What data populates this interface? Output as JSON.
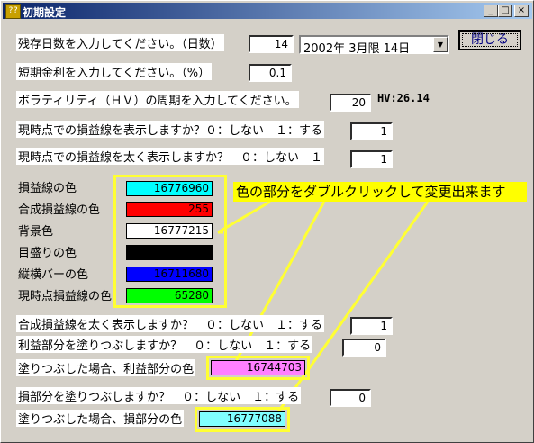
{
  "window": {
    "title": "初期設定",
    "icon_text": "??",
    "icon": "app-icon"
  },
  "caption_buttons": {
    "minimize": "_",
    "maximize": "□",
    "close": "×"
  },
  "days": {
    "label": "残存日数を入力してください。（日数）",
    "value": "14",
    "expiry_selected": "2002年 3月限  14日",
    "dropdown_icon": "▼"
  },
  "close_button_label": "閉じる",
  "rate": {
    "label": "短期金利を入力してください。（%）",
    "value": "0.1"
  },
  "hv": {
    "label": "ボラティリティ（ＨＶ）の周期を入力してください。",
    "value": "20",
    "readout": "HV:26.14"
  },
  "show_pl_line": {
    "label": "現時点での損益線を表示しますか？０：しない　１：する",
    "value": "1"
  },
  "bold_pl_line": {
    "label": "現時点での損益線を太く表示しますか？　０：しない　１",
    "value": "1"
  },
  "colors": [
    {
      "label": "損益線の色",
      "value": "16776960",
      "color": "#00ffff"
    },
    {
      "label": "合成損益線の色",
      "value": "255",
      "color": "#ff0000"
    },
    {
      "label": "背景色",
      "value": "16777215",
      "color": "#ffffff"
    },
    {
      "label": "目盛りの色",
      "value": "",
      "color": "#000000"
    },
    {
      "label": "縦横バーの色",
      "value": "16711680",
      "color": "#0000ff"
    },
    {
      "label": "現時点損益線の色",
      "value": "65280",
      "color": "#00ff00"
    }
  ],
  "annotation": "色の部分をダブルクリックして変更出来ます",
  "bold_composite": {
    "label": "合成損益線を太く表示しますか？　０：しない　１：する",
    "value": "1"
  },
  "fill_profit": {
    "label": "利益部分を塗りつぶしますか？　０：しない　１：する",
    "value": "0"
  },
  "profit_color": {
    "label": "塗りつぶした場合、利益部分の色",
    "value": "16744703",
    "color": "#ff80ff"
  },
  "fill_loss": {
    "label": "損部分を塗りつぶしますか？　０：しない　１：する",
    "value": "0"
  },
  "loss_color": {
    "label": "塗りつぶした場合、損部分の色",
    "value": "16777088",
    "color": "#80ffff"
  },
  "accent": {
    "highlight": "#ffff33",
    "titlebar_start": "#0a246a",
    "titlebar_end": "#a6caf0"
  }
}
